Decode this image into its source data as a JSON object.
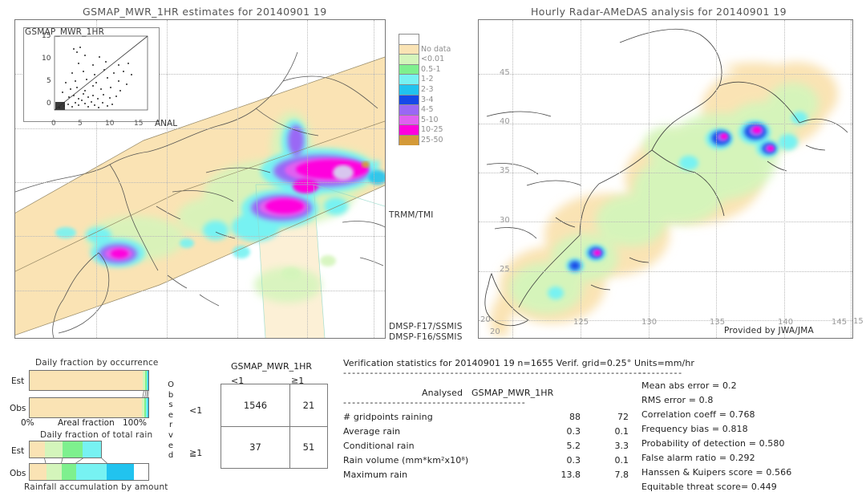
{
  "left_panel": {
    "title": "GSMAP_MWR_1HR estimates for 20140901 19",
    "inset": {
      "title": "GSMAP_MWR_1HR",
      "x_label": "ANAL",
      "y_ticks": [
        "15",
        "10",
        "5",
        "0"
      ],
      "x_ticks": [
        "0",
        "5",
        "10",
        "15"
      ]
    },
    "satellite_labels": [
      "TRMM/TMI",
      "DMSP-F17/SSMIS",
      "DMSP-F16/SSMIS"
    ]
  },
  "right_panel": {
    "title": "Hourly Radar-AMeDAS analysis for 20140901 19",
    "credit": "Provided by JWA/JMA",
    "lat_ticks": [
      "45",
      "40",
      "35",
      "30",
      "25",
      "20"
    ],
    "lon_ticks": [
      "125",
      "130",
      "135",
      "140",
      "145",
      "15"
    ],
    "corner_tick": "20"
  },
  "colorbar": {
    "labels": [
      "No data",
      "<0.01",
      "0.5-1",
      "1-2",
      "2-3",
      "3-4",
      "4-5",
      "5-10",
      "10-25",
      "25-50"
    ],
    "colors": [
      "#ffffff",
      "#fae3b4",
      "#d4f5bb",
      "#7ef08e",
      "#77f2f2",
      "#21c3ef",
      "#1649e8",
      "#9a67f5",
      "#e060f0",
      "#ff00dd",
      "#d49a38"
    ]
  },
  "occurrence_chart": {
    "title": "Daily fraction by occurrence",
    "row_labels": [
      "Est",
      "Obs"
    ],
    "axis_left": "0%",
    "axis_center": "Areal fraction",
    "axis_right": "100%",
    "est_segments": [
      {
        "color": "#fae3b4",
        "pct": 95.6
      },
      {
        "color": "#d4f5bb",
        "pct": 1.6
      },
      {
        "color": "#7ef08e",
        "pct": 1.2
      },
      {
        "color": "#77f2f2",
        "pct": 1.0
      },
      {
        "color": "#21c3ef",
        "pct": 0.6
      }
    ],
    "obs_segments": [
      {
        "color": "#fae3b4",
        "pct": 94.7
      },
      {
        "color": "#d4f5bb",
        "pct": 1.8
      },
      {
        "color": "#7ef08e",
        "pct": 1.5
      },
      {
        "color": "#77f2f2",
        "pct": 1.2
      },
      {
        "color": "#21c3ef",
        "pct": 0.8
      }
    ]
  },
  "amount_chart": {
    "title": "Daily fraction of total rain",
    "footer": "Rainfall accumulation by amount",
    "row_labels": [
      "Est",
      "Obs"
    ],
    "est_total_pct": 60.5,
    "est_segments": [
      {
        "color": "#fae3b4",
        "pct": 13.0
      },
      {
        "color": "#d4f5bb",
        "pct": 15.0
      },
      {
        "color": "#7ef08e",
        "pct": 17.0
      },
      {
        "color": "#77f2f2",
        "pct": 15.5
      }
    ],
    "obs_segments": [
      {
        "color": "#fae3b4",
        "pct": 14.0
      },
      {
        "color": "#d4f5bb",
        "pct": 13.0
      },
      {
        "color": "#7ef08e",
        "pct": 12.0
      },
      {
        "color": "#77f2f2",
        "pct": 26.0
      },
      {
        "color": "#21c3ef",
        "pct": 23.0
      }
    ]
  },
  "contingency": {
    "header": "GSMAP_MWR_1HR",
    "col_labels": [
      "<1",
      "≧1"
    ],
    "row_labels": [
      "<1",
      "≧1"
    ],
    "side_label": "Observed",
    "cells": [
      [
        "1546",
        "21"
      ],
      [
        "37",
        "51"
      ]
    ]
  },
  "verification": {
    "header": "Verification statistics for 20140901 19  n=1655  Verif. grid=0.25°  Units=mm/hr",
    "col_headers": [
      "Analysed",
      "GSMAP_MWR_1HR"
    ],
    "rows": [
      {
        "label": "# gridpoints raining",
        "analysed": "88",
        "estimate": "72"
      },
      {
        "label": "Average rain",
        "analysed": "0.3",
        "estimate": "0.1"
      },
      {
        "label": "Conditional rain",
        "analysed": "5.2",
        "estimate": "3.3"
      },
      {
        "label": "Rain volume (mm*km²x10⁸)",
        "analysed": "0.3",
        "estimate": "0.1"
      },
      {
        "label": "Maximum rain",
        "analysed": "13.8",
        "estimate": "7.8"
      }
    ],
    "scores": [
      "Mean abs error = 0.2",
      "RMS error = 0.8",
      "Correlation coeff = 0.768",
      "Frequency bias = 0.818",
      "Probability of detection = 0.580",
      "False alarm ratio = 0.292",
      "Hanssen & Kuipers score = 0.566",
      "Equitable threat score= 0.449"
    ]
  }
}
